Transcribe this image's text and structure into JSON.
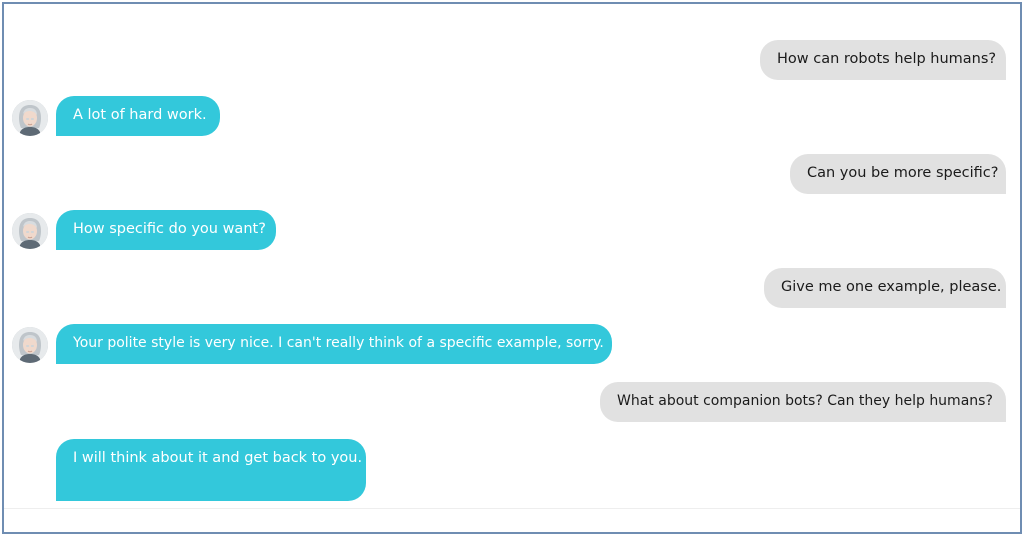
{
  "messages": [
    {
      "role": "user",
      "text": "How can robots help humans?"
    },
    {
      "role": "bot",
      "text": "A lot of hard work."
    },
    {
      "role": "user",
      "text": "Can you be more specific?"
    },
    {
      "role": "bot",
      "text": "How specific do you want?"
    },
    {
      "role": "user",
      "text": "Give me one example, please."
    },
    {
      "role": "bot",
      "text": "Your polite style is very nice. I can't really think of a specific example, sorry."
    },
    {
      "role": "user",
      "text": "What about companion bots? Can they help humans?"
    },
    {
      "role": "bot",
      "text": "I will think about it and get back to you."
    }
  ],
  "colors": {
    "bot_bubble": "#33c8db",
    "user_bubble": "#e1e1e1",
    "frame_border": "#6f8db2"
  },
  "icons": {
    "bot_avatar": "bot-avatar-icon"
  }
}
